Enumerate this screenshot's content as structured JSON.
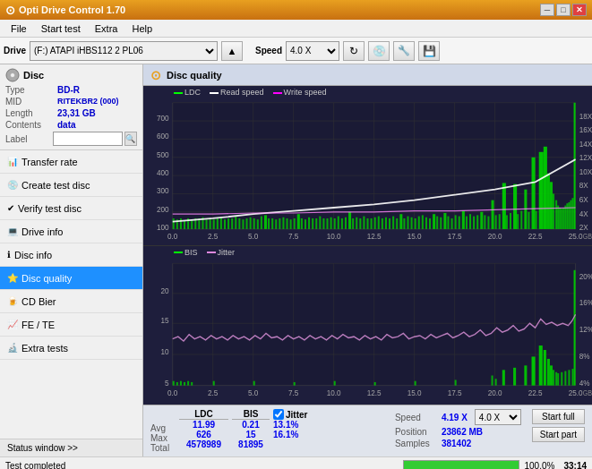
{
  "titlebar": {
    "title": "Opti Drive Control 1.70",
    "icon": "⊙",
    "min": "─",
    "max": "□",
    "close": "✕"
  },
  "menubar": {
    "items": [
      "File",
      "Start test",
      "Extra",
      "Help"
    ]
  },
  "toolbar": {
    "drive_label": "Drive",
    "drive_value": "(F:)  ATAPI iHBS112  2 PL06",
    "speed_label": "Speed",
    "speed_value": "4.0 X"
  },
  "disc": {
    "header": "Disc",
    "type_label": "Type",
    "type_value": "BD-R",
    "mid_label": "MID",
    "mid_value": "RITEKBR2 (000)",
    "length_label": "Length",
    "length_value": "23,31 GB",
    "contents_label": "Contents",
    "contents_value": "data",
    "label_label": "Label",
    "label_value": ""
  },
  "nav": {
    "items": [
      {
        "id": "transfer-rate",
        "label": "Transfer rate",
        "active": false
      },
      {
        "id": "create-test-disc",
        "label": "Create test disc",
        "active": false
      },
      {
        "id": "verify-test-disc",
        "label": "Verify test disc",
        "active": false
      },
      {
        "id": "drive-info",
        "label": "Drive info",
        "active": false
      },
      {
        "id": "disc-info",
        "label": "Disc info",
        "active": false
      },
      {
        "id": "disc-quality",
        "label": "Disc quality",
        "active": true
      },
      {
        "id": "cd-bier",
        "label": "CD Bier",
        "active": false
      },
      {
        "id": "fe-te",
        "label": "FE / TE",
        "active": false
      },
      {
        "id": "extra-tests",
        "label": "Extra tests",
        "active": false
      }
    ]
  },
  "status_window": {
    "label": "Status window >>"
  },
  "status_bar": {
    "text": "Test completed",
    "progress": 100,
    "time": "33:14"
  },
  "disc_quality": {
    "header": "Disc quality",
    "legend": {
      "ldc": "LDC",
      "read_speed": "Read speed",
      "write_speed": "Write speed",
      "bis": "BIS",
      "jitter": "Jitter"
    },
    "chart1": {
      "y_max": 700,
      "y_right_max": 18,
      "x_max": 25,
      "x_labels": [
        "0.0",
        "2.5",
        "5.0",
        "7.5",
        "10.0",
        "12.5",
        "15.0",
        "17.5",
        "20.0",
        "22.5",
        "25.0"
      ],
      "y_labels_left": [
        "100",
        "200",
        "300",
        "400",
        "500",
        "600",
        "700"
      ],
      "y_labels_right": [
        "2X",
        "4X",
        "6X",
        "8X",
        "10X",
        "12X",
        "14X",
        "16X",
        "18X"
      ]
    },
    "chart2": {
      "y_max": 20,
      "y_right_max": 20,
      "x_max": 25,
      "x_labels": [
        "0.0",
        "2.5",
        "5.0",
        "7.5",
        "10.0",
        "12.5",
        "15.0",
        "17.5",
        "20.0",
        "22.5",
        "25.0"
      ],
      "y_labels_left": [
        "5",
        "10",
        "15",
        "20"
      ],
      "y_labels_right": [
        "4%",
        "8%",
        "12%",
        "16%",
        "20%"
      ]
    }
  },
  "stats": {
    "col_ldc": "LDC",
    "col_bis": "BIS",
    "jitter_label": "Jitter",
    "jitter_checked": true,
    "speed_label": "Speed",
    "speed_value": "4.19 X",
    "speed_select": "4.0 X",
    "position_label": "Position",
    "position_value": "23862 MB",
    "samples_label": "Samples",
    "samples_value": "381402",
    "rows": [
      {
        "label": "Avg",
        "ldc": "11.99",
        "bis": "0.21",
        "jitter": "13.1%"
      },
      {
        "label": "Max",
        "ldc": "626",
        "bis": "15",
        "jitter": "16.1%"
      },
      {
        "label": "Total",
        "ldc": "4578989",
        "bis": "81895",
        "jitter": ""
      }
    ],
    "start_full_label": "Start full",
    "start_part_label": "Start part"
  }
}
